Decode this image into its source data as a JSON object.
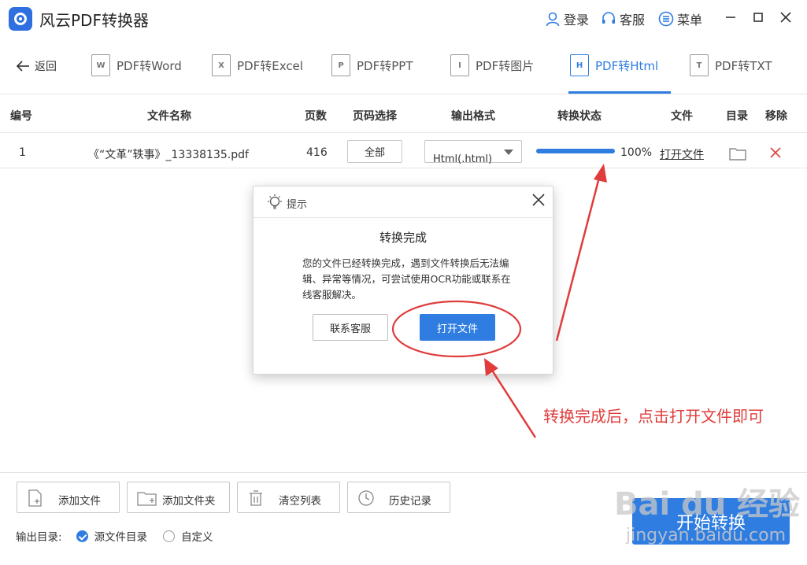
{
  "app": {
    "title": "风云PDF转换器",
    "login": "登录",
    "service": "客服",
    "menu": "菜单"
  },
  "tabs": {
    "back": "返回",
    "items": [
      {
        "label": "PDF转Word",
        "icon": "W"
      },
      {
        "label": "PDF转Excel",
        "icon": "X"
      },
      {
        "label": "PDF转PPT",
        "icon": "P"
      },
      {
        "label": "PDF转图片",
        "icon": "I"
      },
      {
        "label": "PDF转Html",
        "icon": "H"
      },
      {
        "label": "PDF转TXT",
        "icon": "T"
      }
    ],
    "active_index": 4
  },
  "table": {
    "headers": {
      "num": "编号",
      "name": "文件名称",
      "pages": "页数",
      "range": "页码选择",
      "format": "输出格式",
      "status": "转换状态",
      "file": "文件",
      "dir": "目录",
      "remove": "移除"
    },
    "row": {
      "num": "1",
      "name": "《“文革”轶事》_13338135.pdf",
      "pages": "416",
      "range": "全部",
      "format": "Html(.html)",
      "progress": 1.0,
      "progress_text": "100%",
      "open_link": "打开文件"
    }
  },
  "dialog": {
    "title": "提示",
    "heading": "转换完成",
    "body": "您的文件已经转换完成，遇到文件转换后无法编辑、异常等情况，可尝试使用OCR功能或联系在线客服解决。",
    "contact_button": "联系客服",
    "open_button": "打开文件"
  },
  "annotation": {
    "text": "转换完成后，点击打开文件即可",
    "color": "#e03c3c"
  },
  "bottom": {
    "add_file": "添加文件",
    "add_folder": "添加文件夹",
    "clear_list": "清空列表",
    "history": "历史记录",
    "output_dir_label": "输出目录:",
    "option_source": "源文件目录",
    "option_custom": "自定义",
    "start": "开始转换"
  },
  "watermark": {
    "brand": "Bai du 经验",
    "url": "jingyan.baidu.com"
  },
  "colors": {
    "accent": "#2f7de1",
    "danger": "#e04848"
  }
}
